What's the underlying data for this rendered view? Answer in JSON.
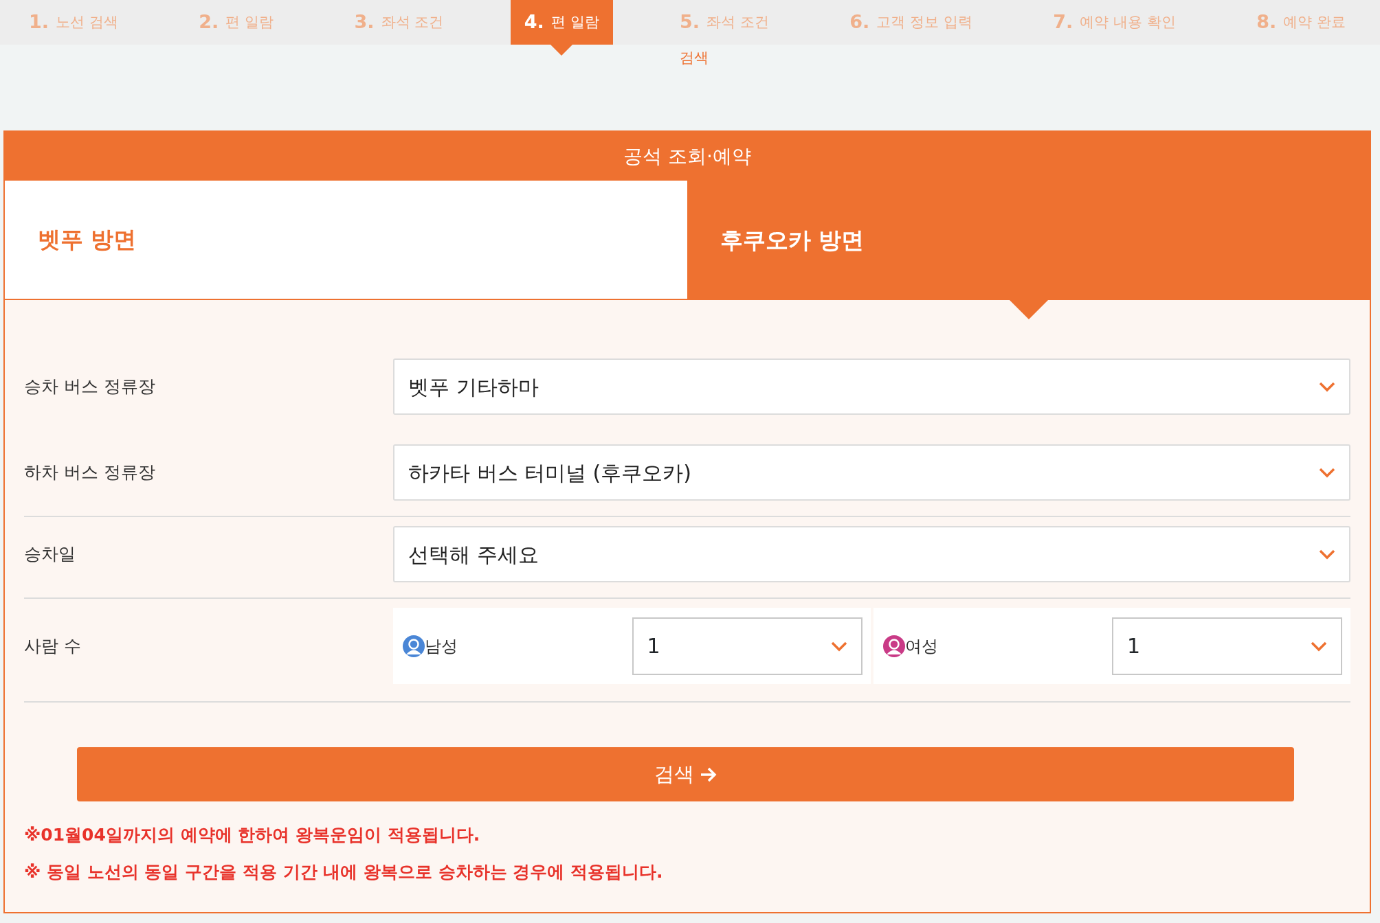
{
  "steps": [
    {
      "number": "1.",
      "label": "노선 검색",
      "selected": false
    },
    {
      "number": "2.",
      "label": "편 일람",
      "selected": false
    },
    {
      "number": "3.",
      "label": "좌석 조건",
      "selected": false
    },
    {
      "number": "4.",
      "label": "편 일람",
      "selected": true
    },
    {
      "number": "5.",
      "label": "좌석 조건",
      "selected": false,
      "caption": "검색"
    },
    {
      "number": "6.",
      "label": "고객 정보 입력",
      "selected": false
    },
    {
      "number": "7.",
      "label": "예약 내용 확인",
      "selected": false
    },
    {
      "number": "8.",
      "label": "예약 완료",
      "selected": false
    }
  ],
  "panel": {
    "title": "공석 조회·예약",
    "tabs": [
      {
        "label": "벳푸 방면",
        "selected": false
      },
      {
        "label": "후쿠오카 방면",
        "selected": true
      }
    ],
    "fields": [
      {
        "kind": "select",
        "label": "승차 버스 정류장",
        "value": "벳푸 기타하마",
        "divider": false
      },
      {
        "kind": "select",
        "label": "하차 버스 정류장",
        "value": "하카타 버스 터미널 (후쿠오카)",
        "divider": true
      },
      {
        "kind": "select",
        "label": "승차일",
        "value": "선택해 주세요",
        "divider": true
      },
      {
        "kind": "people",
        "label": "사람 수",
        "divider": true,
        "groups": [
          {
            "label": "남성",
            "color": "#4a86d6",
            "value": "1"
          },
          {
            "label": "여성",
            "color": "#c93a86",
            "value": "1"
          }
        ]
      }
    ],
    "search_button": "검색",
    "notes": [
      "※01월04일까지의 예약에 한하여 왕복운임이 적용됩니다.",
      "※ 동일 노선의 동일 구간을 적용 기간 내에 왕복으로 승차하는 경우에 적용됩니다."
    ]
  }
}
